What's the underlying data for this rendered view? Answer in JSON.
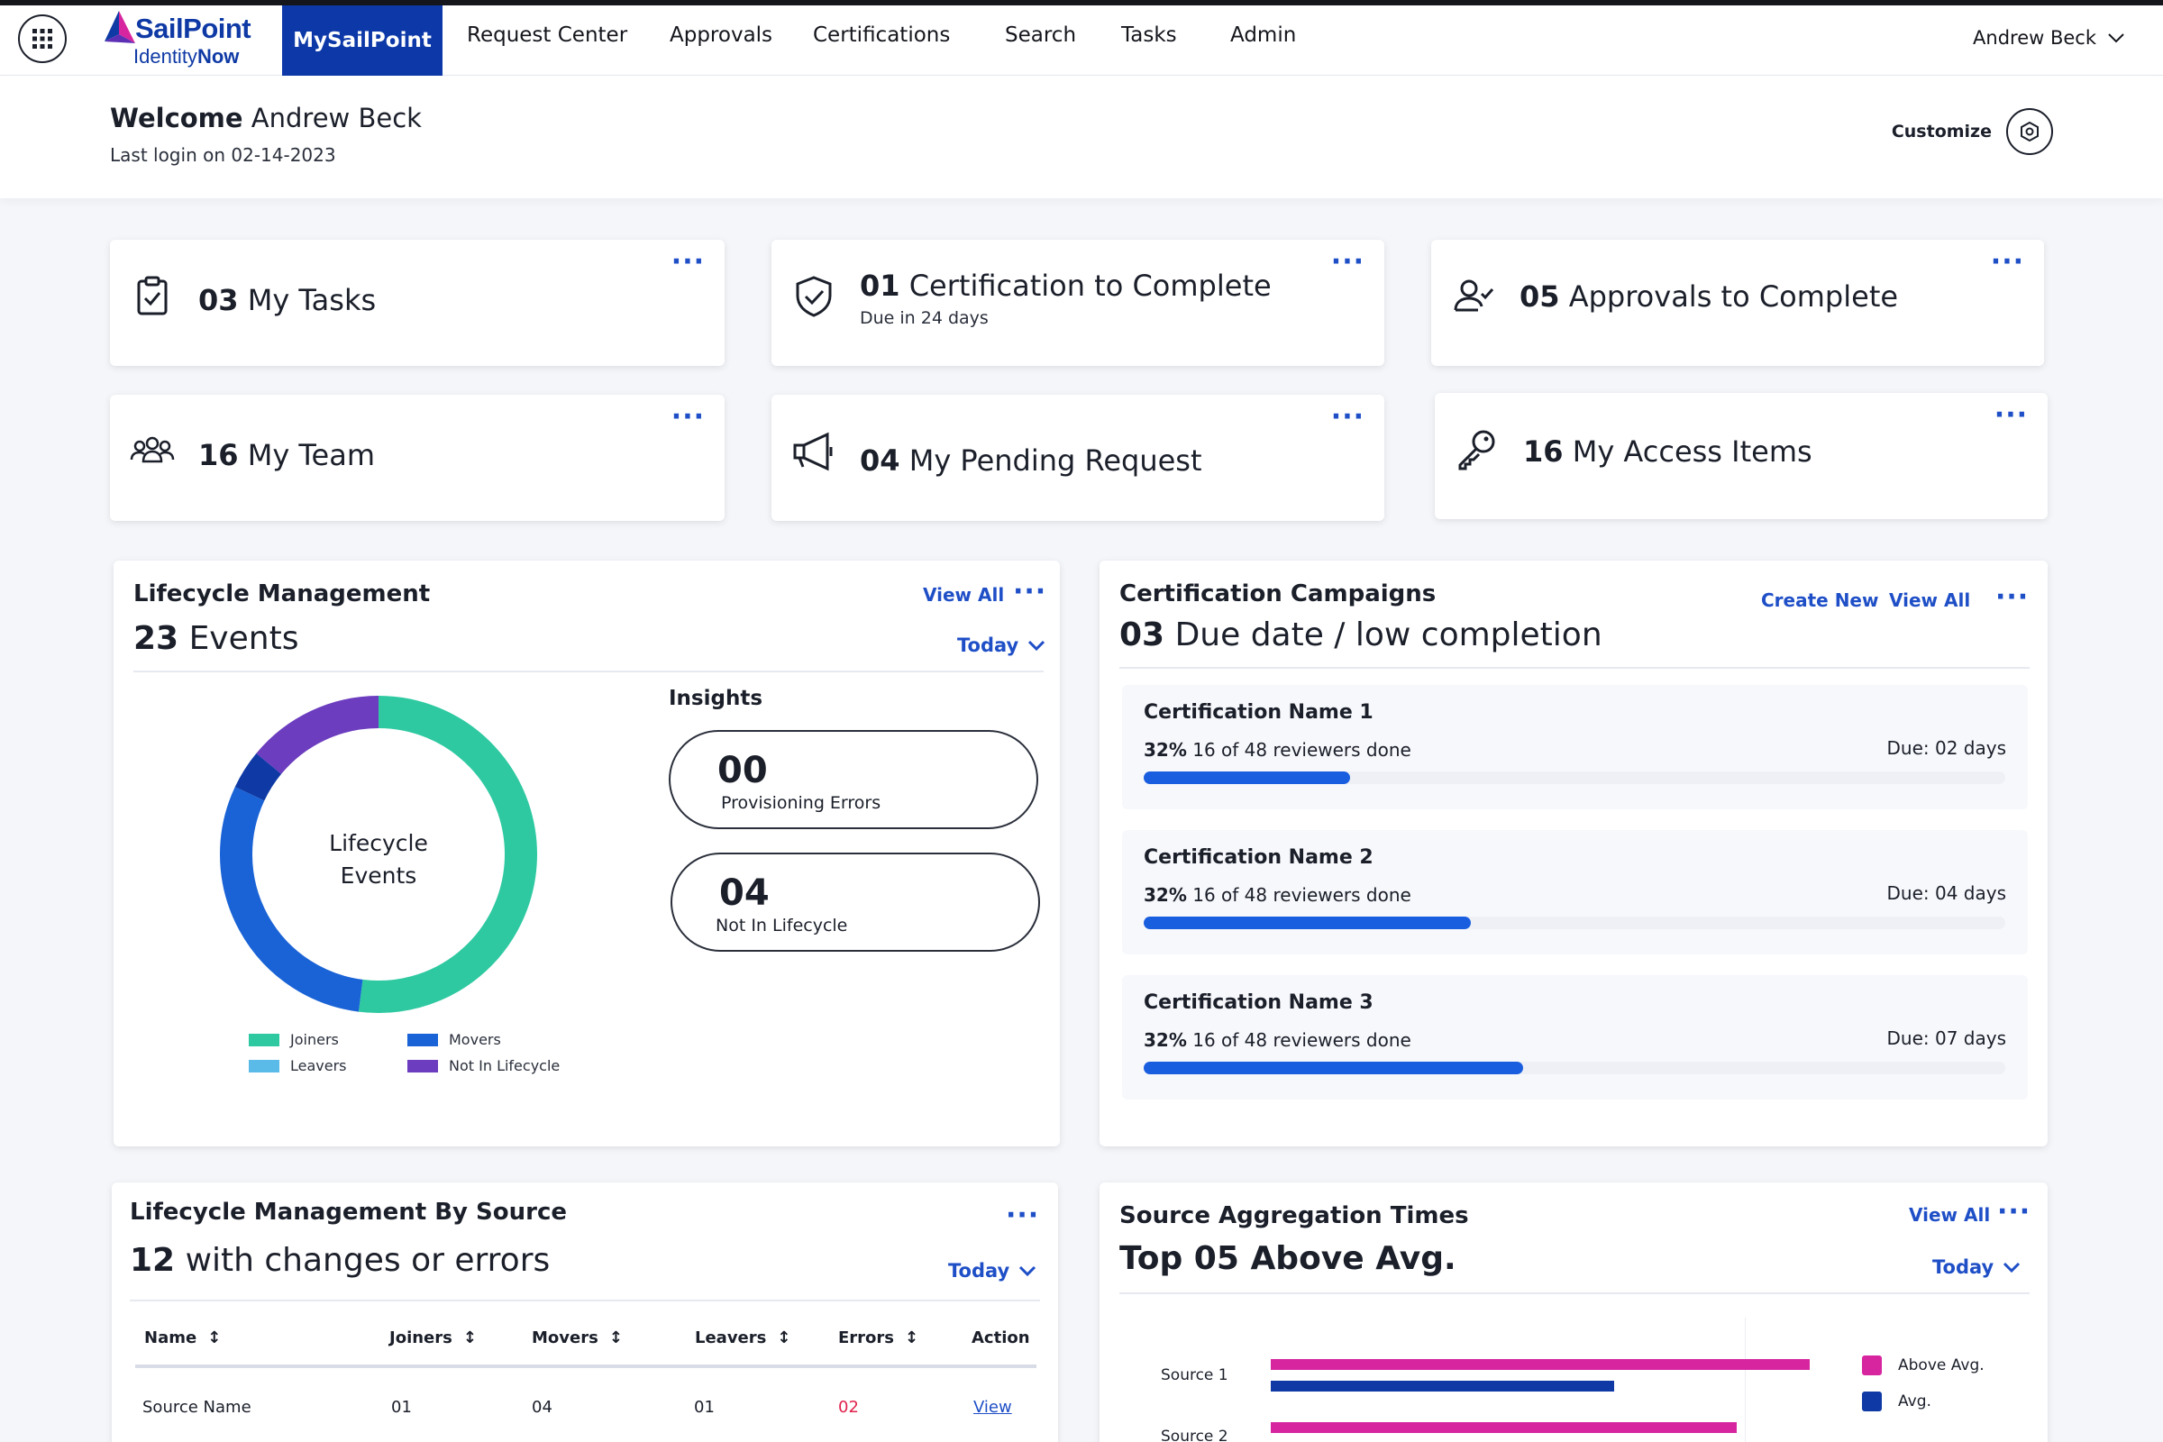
{
  "nav": {
    "logo_main": "SailPoint",
    "logo_sub_a": "Identity",
    "logo_sub_b": "Now",
    "active": "MySailPoint",
    "items": [
      "Request Center",
      "Approvals",
      "Certifications",
      "Search",
      "Tasks",
      "Admin"
    ],
    "user": "Andrew Beck"
  },
  "welcome": {
    "greeting": "Welcome",
    "name": "Andrew Beck",
    "last_login": "Last login on 02-14-2023",
    "customize": "Customize"
  },
  "stats": [
    {
      "num": "03",
      "label": "My Tasks",
      "sub": "",
      "icon": "clipboard-check-icon"
    },
    {
      "num": "01",
      "label": "Certification to Complete",
      "sub": "Due in 24 days",
      "icon": "shield-check-icon"
    },
    {
      "num": "05",
      "label": "Approvals to Complete",
      "sub": "",
      "icon": "user-check-icon"
    },
    {
      "num": "16",
      "label": "My Team",
      "sub": "",
      "icon": "team-icon"
    },
    {
      "num": "04",
      "label": "My Pending Request",
      "sub": "",
      "icon": "megaphone-icon"
    },
    {
      "num": "16",
      "label": "My Access Items",
      "sub": "",
      "icon": "key-icon"
    }
  ],
  "lifecycle": {
    "title": "Lifecycle Management",
    "count": "23",
    "count_label": "Events",
    "view_all": "View All",
    "period": "Today",
    "donut_center_1": "Lifecycle",
    "donut_center_2": "Events",
    "insights_label": "Insights",
    "insights": [
      {
        "num": "00",
        "label": "Provisioning Errors"
      },
      {
        "num": "04",
        "label": "Not In Lifecycle"
      }
    ]
  },
  "chart_data": {
    "type": "pie",
    "title": "Lifecycle Events",
    "series": [
      {
        "name": "Joiners",
        "value": 52,
        "color": "#2ec9a1"
      },
      {
        "name": "Movers",
        "value": 30,
        "color": "#1a63d6"
      },
      {
        "name": "Leavers",
        "value": 4,
        "color": "#0f3aa5"
      },
      {
        "name": "Not In Lifecycle",
        "value": 14,
        "color": "#6c3dbf"
      }
    ],
    "legend": [
      {
        "name": "Joiners",
        "color": "#2ec9a1"
      },
      {
        "name": "Movers",
        "color": "#1a63d6"
      },
      {
        "name": "Leavers",
        "color": "#5bbbe8"
      },
      {
        "name": "Not In Lifecycle",
        "color": "#6c3dbf"
      }
    ]
  },
  "certs": {
    "title": "Certification Campaigns",
    "count": "03",
    "count_label": "Due date / low completion",
    "create_new": "Create New",
    "view_all": "View All",
    "items": [
      {
        "name": "Certification Name 1",
        "pct": "32%",
        "progress_text": "16 of 48 reviewers done",
        "due": "Due: 02 days",
        "fill": 0.24
      },
      {
        "name": "Certification Name 2",
        "pct": "32%",
        "progress_text": "16 of 48 reviewers done",
        "due": "Due: 04 days",
        "fill": 0.38
      },
      {
        "name": "Certification Name 3",
        "pct": "32%",
        "progress_text": "16 of 48 reviewers done",
        "due": "Due: 07 days",
        "fill": 0.44
      }
    ]
  },
  "bysource": {
    "title": "Lifecycle Management By Source",
    "count": "12",
    "count_label": "with changes or errors",
    "period": "Today",
    "columns": [
      "Name",
      "Joiners",
      "Movers",
      "Leavers",
      "Errors",
      "Action"
    ],
    "rows": [
      {
        "name": "Source Name",
        "joiners": "01",
        "movers": "04",
        "leavers": "01",
        "errors": "02",
        "action": "View"
      }
    ]
  },
  "aggregation": {
    "title": "Source Aggregation Times",
    "headline": "Top 05 Above Avg.",
    "view_all": "View All",
    "period": "Today",
    "legend": [
      {
        "name": "Above Avg.",
        "color": "#d6259f"
      },
      {
        "name": "Avg.",
        "color": "#0f3aa5"
      }
    ],
    "sources": [
      {
        "name": "Source 1",
        "above": 0.88,
        "avg": 0.56
      },
      {
        "name": "Source 2",
        "above": 0.76,
        "avg": 0
      }
    ]
  }
}
